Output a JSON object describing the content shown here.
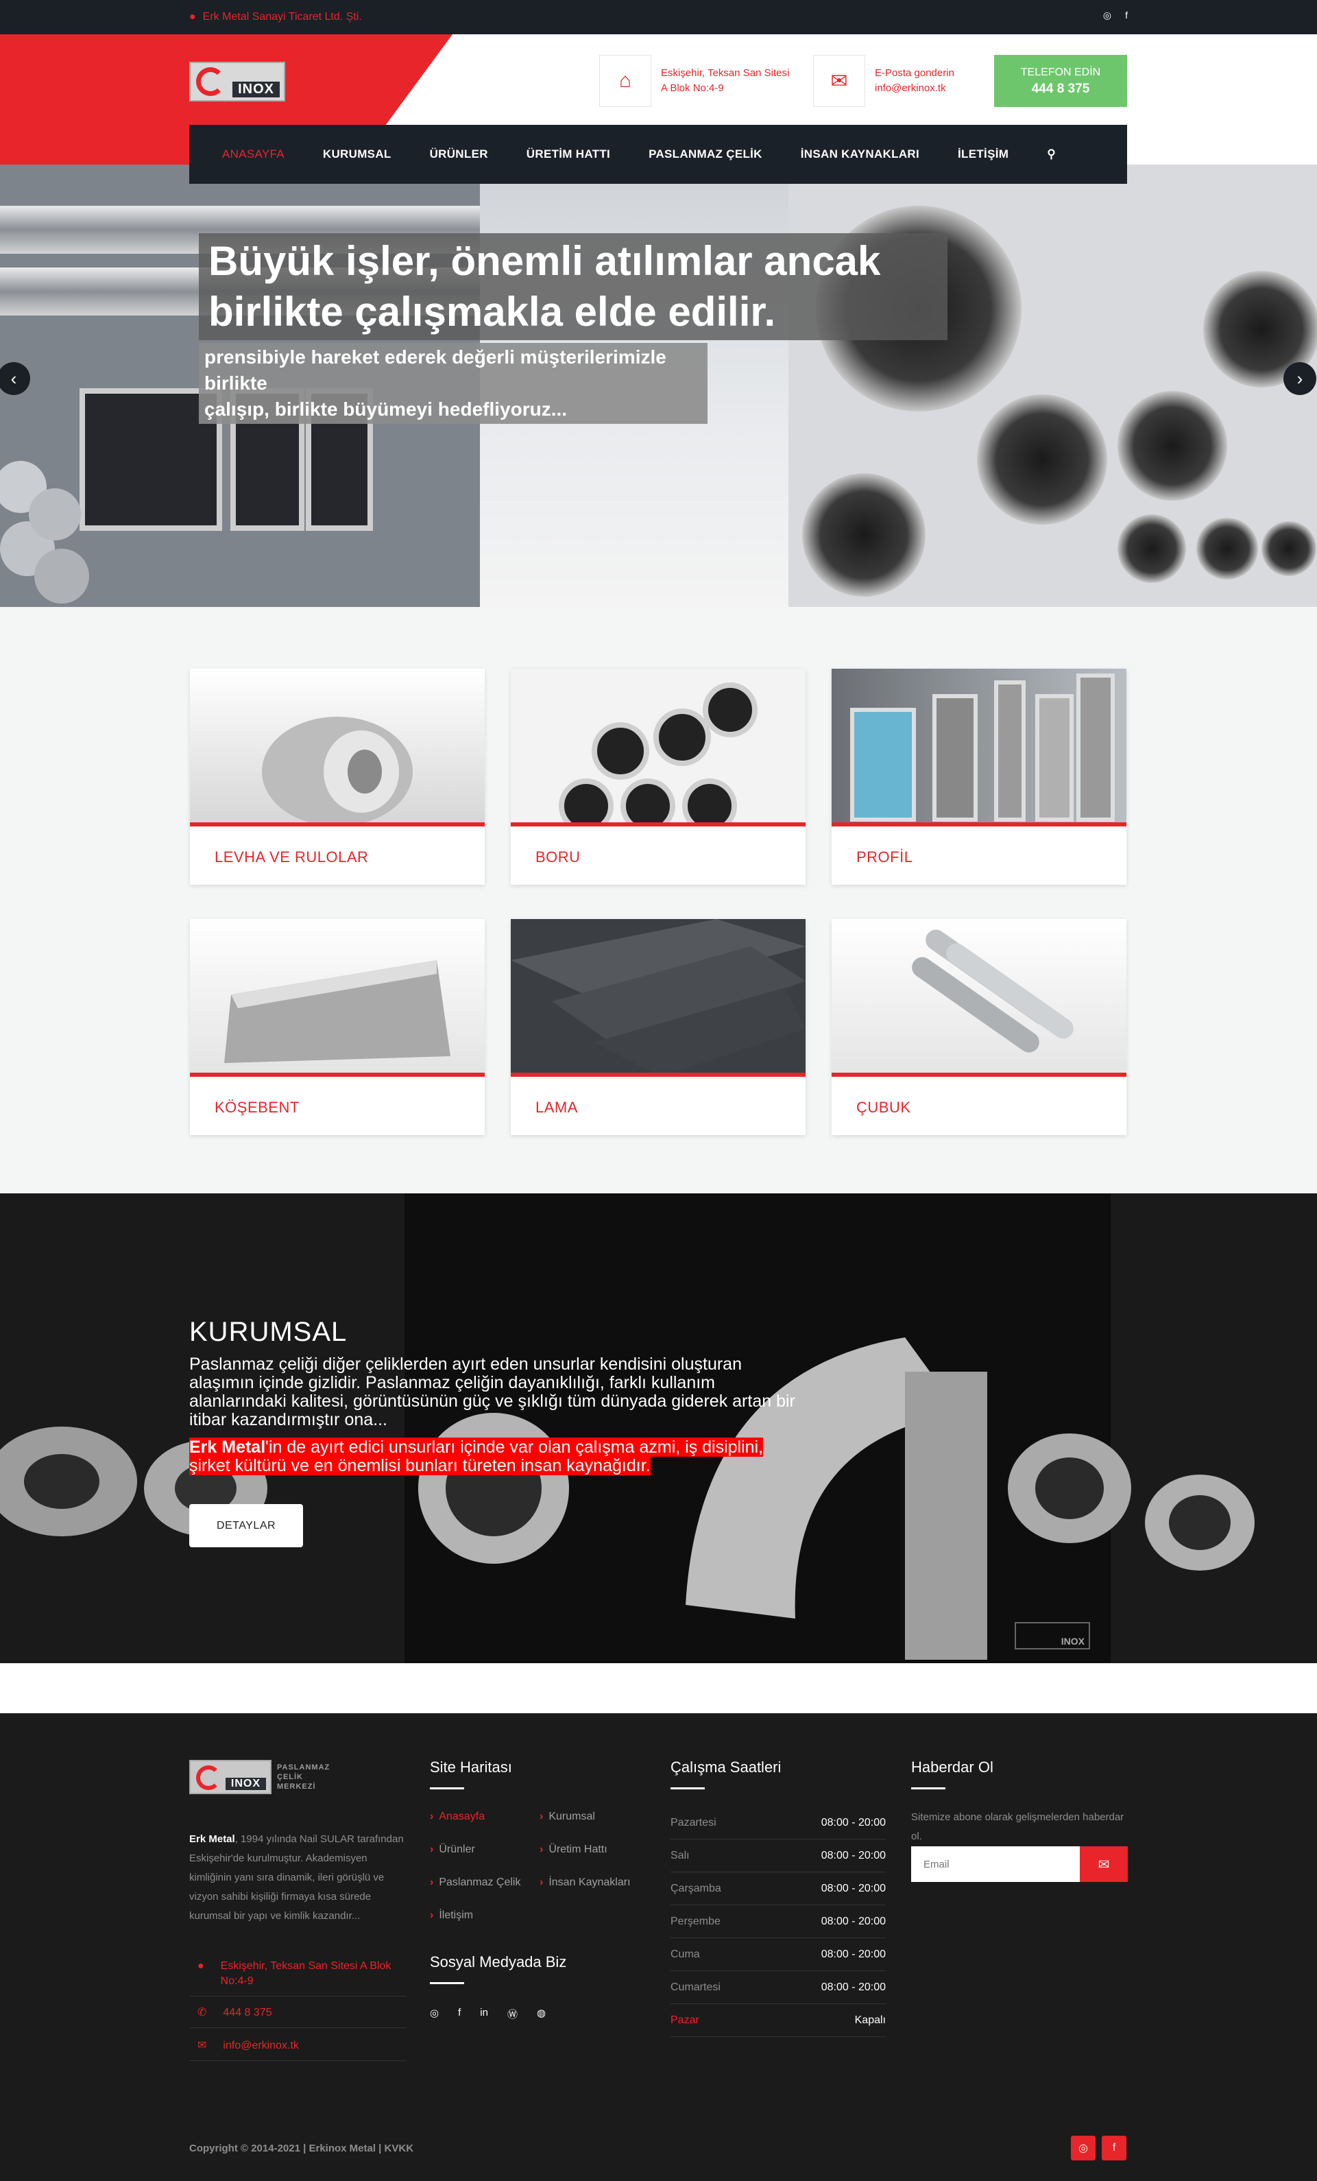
{
  "topbar": {
    "address": "Erk Metal Sanayi Ticaret Ltd. Şti.",
    "social": [
      "instagram-icon",
      "facebook-icon"
    ]
  },
  "logo": {
    "inox": "INOX",
    "tagline_1": "PASLANMAZ",
    "tagline_2": "ÇELİK",
    "tagline_3": "MERKEZİ"
  },
  "header": {
    "address_line1": "Eskişehir, Teksan San Sitesi",
    "address_line2": "A Blok No:4-9",
    "email_line1": "E-Posta gonderin",
    "email_line2": "info@erkinox.tk",
    "phone_label": "TELEFON EDİN",
    "phone_number": "444 8 375"
  },
  "nav": {
    "items": [
      "ANASAYFA",
      "KURUMSAL",
      "ÜRÜNLER",
      "ÜRETİM HATTI",
      "PASLANMAZ ÇELİK",
      "İNSAN KAYNAKLARI",
      "İLETİŞİM"
    ],
    "active_index": 0
  },
  "hero": {
    "headline_1": "Büyük işler, önemli atılımlar ancak",
    "headline_2": "birlikte çalışmakla elde edilir.",
    "sub_1": "prensibiyle hareket ederek değerli müşterilerimizle birlikte",
    "sub_2": "çalışıp, birlikte büyümeyi hedefliyoruz..."
  },
  "products": [
    "LEVHA VE RULOLAR",
    "BORU",
    "PROFİL",
    "KÖŞEBENT",
    "LAMA",
    "ÇUBUK"
  ],
  "about": {
    "title": "KURUMSAL",
    "para1": "Paslanmaz çeliği diğer çeliklerden ayırt eden unsurlar kendisini oluşturan alaşımın içinde gizlidir. Paslanmaz çeliğin dayanıklılığı, farklı kullanım alanlarındaki kalitesi, görüntüsünün güç ve şıklığı tüm dünyada giderek artan bir itibar kazandırmıştır ona...",
    "para2_bold": "Erk Metal",
    "para2_rest": "'in de ayırt edici unsurları içinde var olan çalışma azmi, iş disiplini, şirket kültürü ve en önemlisi bunları türeten insan kaynağıdır.",
    "button": "DETAYLAR"
  },
  "footer": {
    "about_bold": "Erk Metal",
    "about_text": ", 1994 yılında Nail SULAR tarafından Eskişehir'de kurulmuştur. Akademisyen kimliğinin yanı sıra dinamik, ileri görüşlü ve vizyon sahibi kişiliği firmaya kısa sürede kurumsal bir yapı ve kimlik kazandır...",
    "contact_address": "Eskişehir, Teksan San Sitesi A Blok No:4-9",
    "contact_phone": "444 8 375",
    "contact_email": "info@erkinox.tk",
    "sitemap_title": "Site Haritası",
    "sitemap": [
      "Anasayfa",
      "Kurumsal",
      "Ürünler",
      "Üretim Hattı",
      "Paslanmaz Çelik",
      "İnsan Kaynakları",
      "İletişim"
    ],
    "social_title": "Sosyal Medyada Biz",
    "hours_title": "Çalışma Saatleri",
    "hours": [
      {
        "day": "Pazartesi",
        "time": "08:00 - 20:00"
      },
      {
        "day": "Salı",
        "time": "08:00 - 20:00"
      },
      {
        "day": "Çarşamba",
        "time": "08:00 - 20:00"
      },
      {
        "day": "Perşembe",
        "time": "08:00 - 20:00"
      },
      {
        "day": "Cuma",
        "time": "08:00 - 20:00"
      },
      {
        "day": "Cumartesi",
        "time": "08:00 - 20:00"
      },
      {
        "day": "Pazar",
        "time": "Kapalı"
      }
    ],
    "newsletter_title": "Haberdar Ol",
    "newsletter_text": "Sitemize abone olarak gelişmelerden haberdar ol.",
    "email_placeholder": "Email",
    "copyright": "Copyright © 2014-2021 | Erkinox Metal | KVKK"
  },
  "colors": {
    "accent": "#e8252a",
    "dark": "#1b1f26",
    "green": "#6ec66c"
  }
}
